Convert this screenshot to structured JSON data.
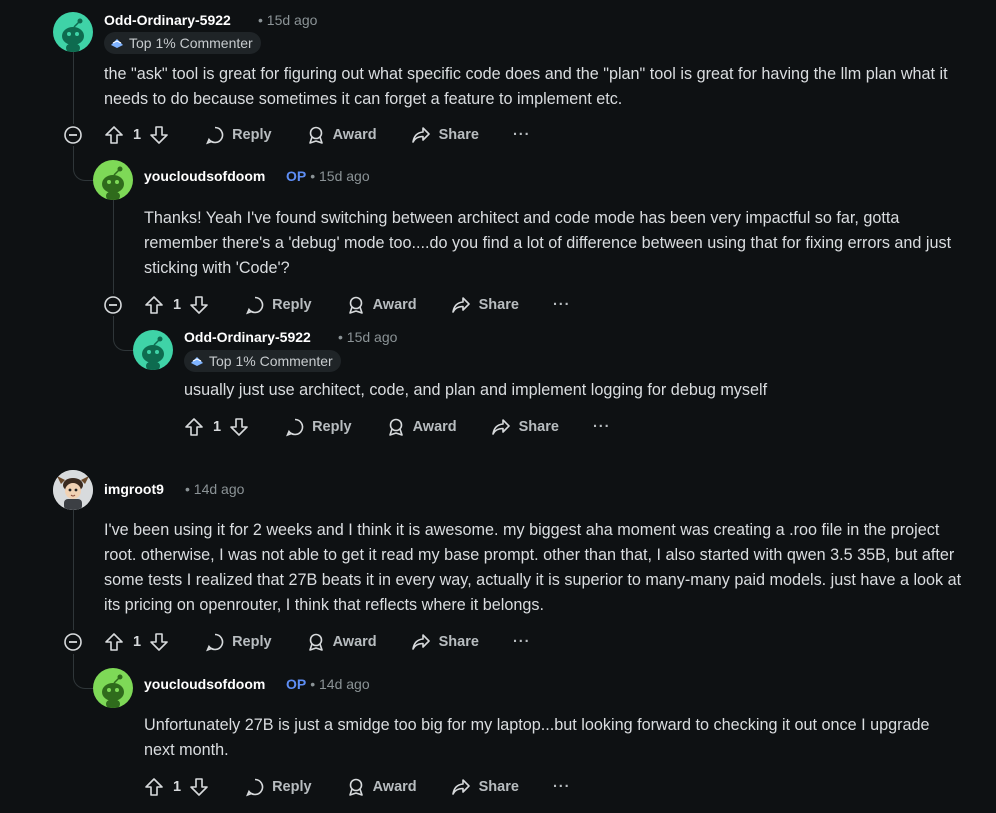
{
  "comments": [
    {
      "author": "Odd-Ordinary-5922",
      "time": "• 15d ago",
      "badge": "Top 1% Commenter",
      "body": "the \"ask\" tool is great for figuring out what specific code does and the \"plan\" tool is great for having the llm plan what it needs to do because sometimes it can forget a feature to implement etc.",
      "votes": "1",
      "actions": {
        "reply": "Reply",
        "award": "Award",
        "share": "Share",
        "more": "···"
      }
    },
    {
      "author": "youcloudsofdoom",
      "op": "OP",
      "time": "• 15d ago",
      "body": "Thanks! Yeah I've found switching between architect and code mode has been very impactful so far, gotta remember there's a 'debug' mode too....do you find a lot of difference between using that for fixing errors and just sticking with 'Code'?",
      "votes": "1",
      "actions": {
        "reply": "Reply",
        "award": "Award",
        "share": "Share",
        "more": "···"
      }
    },
    {
      "author": "Odd-Ordinary-5922",
      "time": "• 15d ago",
      "badge": "Top 1% Commenter",
      "body": "usually just use architect, code, and plan and implement logging for debug myself",
      "votes": "1",
      "actions": {
        "reply": "Reply",
        "award": "Award",
        "share": "Share",
        "more": "···"
      }
    },
    {
      "author": "imgroot9",
      "time": "• 14d ago",
      "body": "I've been using it for 2 weeks and I think it is awesome. my biggest aha moment was creating a .roo file in the project root. otherwise, I was not able to get it read my base prompt. other than that, I also started with qwen 3.5 35B, but after some tests I realized that 27B beats it in every way, actually it is superior to many-many paid models. just have a look at its pricing on openrouter, I think that reflects where it belongs.",
      "votes": "1",
      "actions": {
        "reply": "Reply",
        "award": "Award",
        "share": "Share",
        "more": "···"
      }
    },
    {
      "author": "youcloudsofdoom",
      "op": "OP",
      "time": "• 14d ago",
      "body": "Unfortunately 27B is just a smidge too big for my laptop...but looking forward to checking it out once I upgrade next month.",
      "votes": "1",
      "actions": {
        "reply": "Reply",
        "award": "Award",
        "share": "Share",
        "more": "···"
      }
    }
  ],
  "colors": {
    "background": "#0e1113",
    "text": "#dadde0",
    "meta": "#8b9396",
    "op": "#5e8ef5",
    "avatar_teal": "#3fd3a7",
    "avatar_green": "#7ed957"
  }
}
